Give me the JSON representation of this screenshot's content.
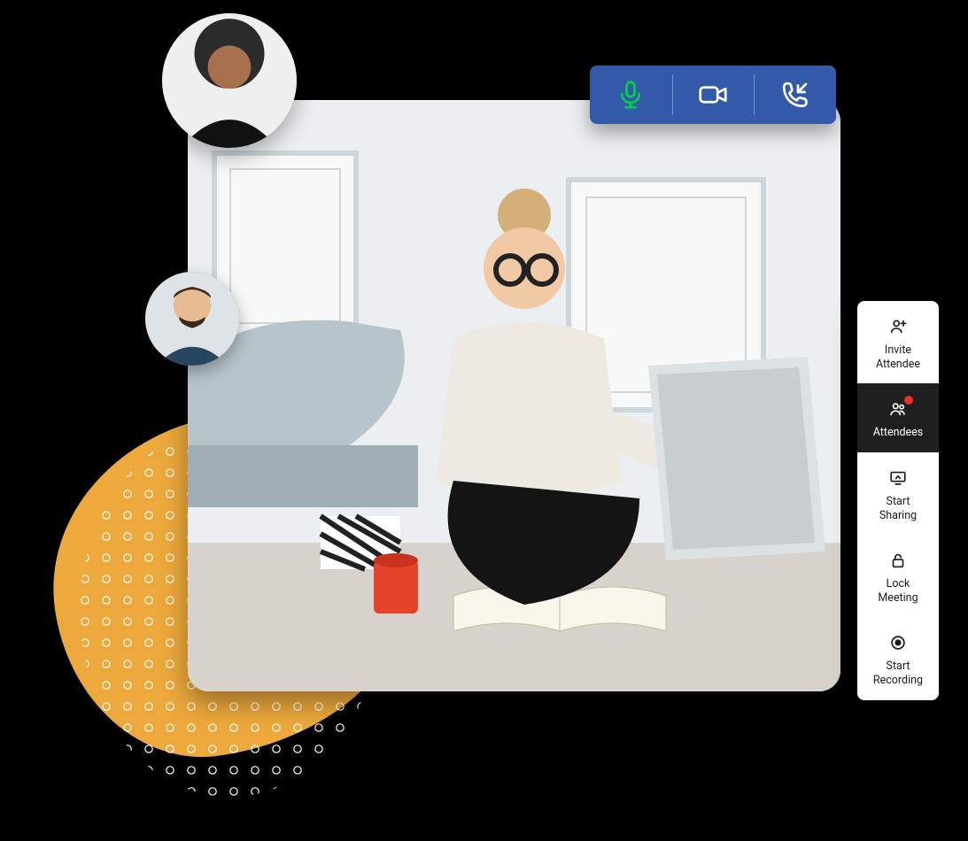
{
  "colors": {
    "primary": "#325AA8",
    "accent": "#00C853",
    "warn": "#E5332A",
    "blob": "#EDA93B"
  },
  "controls": {
    "mic_icon": "mic-icon",
    "camera_icon": "camera-icon",
    "incoming_call_icon": "incoming-call-icon"
  },
  "sidebar": {
    "items": [
      {
        "icon": "invite-attendee-icon",
        "label": "Invite\nAttendee",
        "active": false,
        "badge": false
      },
      {
        "icon": "attendees-icon",
        "label": "Attendees",
        "active": true,
        "badge": true
      },
      {
        "icon": "share-screen-icon",
        "label": "Start\nSharing",
        "active": false,
        "badge": false
      },
      {
        "icon": "lock-icon",
        "label": "Lock\nMeeting",
        "active": false,
        "badge": false
      },
      {
        "icon": "record-icon",
        "label": "Start\nRecording",
        "active": false,
        "badge": false
      }
    ]
  },
  "avatars": [
    {
      "name": "participant-avatar-1"
    },
    {
      "name": "participant-avatar-2"
    }
  ]
}
